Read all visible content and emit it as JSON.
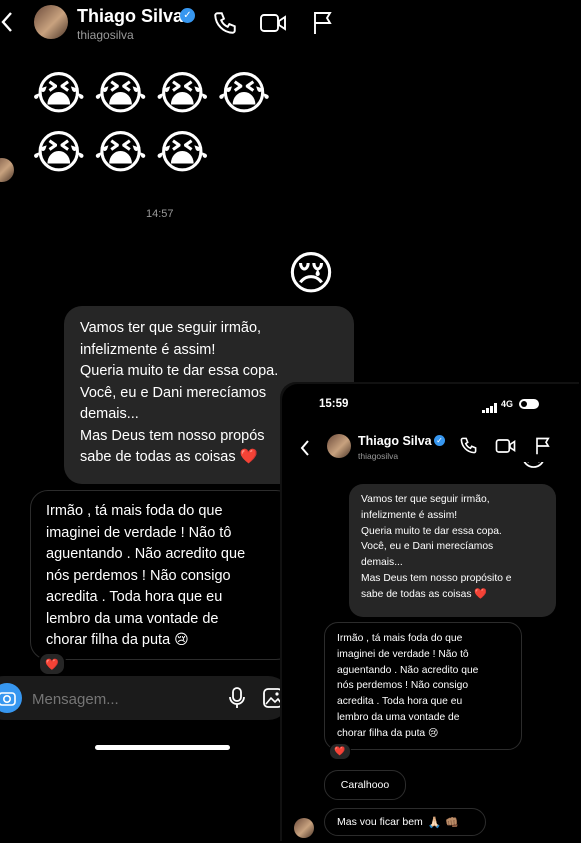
{
  "main": {
    "header": {
      "name": "Thiago Silva",
      "username": "thiagosilva",
      "back_glyph": "<",
      "icons": [
        "phone-icon",
        "video-icon",
        "flag-icon"
      ]
    },
    "emoji_rows": [
      [
        "😭",
        "😭",
        "😭",
        "😭"
      ],
      [
        "😭",
        "😭",
        "😭"
      ]
    ],
    "timestamp": "14:57",
    "sad_emoji": "😢",
    "sent_message": {
      "lines": [
        "Vamos ter que seguir irmão,",
        "infelizmente é assim!",
        "Queria muito te dar essa copa.",
        "Você, eu e Dani merecíamos",
        "demais...",
        "Mas Deus tem nosso propós",
        "sabe de todas as coisas"
      ],
      "heart": "❤️"
    },
    "received_message": {
      "lines": [
        "Irmão , tá mais foda do que",
        "imaginei de verdade ! Não tô",
        "aguentando . Não acredito que",
        "nós perdemos ! Não consigo",
        "acredita . Toda hora que eu",
        "lembro da uma vontade de",
        "chorar filha da puta"
      ],
      "end_emoji": "😢",
      "reaction": "❤️"
    },
    "composer": {
      "placeholder": "Mensagem...",
      "icons": [
        "camera-icon",
        "microphone-icon",
        "gallery-icon"
      ]
    }
  },
  "inset": {
    "status": {
      "time": "15:59",
      "network": "4G"
    },
    "header": {
      "name": "Thiago Silva",
      "username": "thiagosilva"
    },
    "sent_message": {
      "lines": [
        "Vamos ter que seguir irmão,",
        "infelizmente é assim!",
        "Queria muito te dar essa copa.",
        "Você, eu e Dani merecíamos",
        "demais...",
        "Mas Deus tem nosso propósito e",
        "sabe de todas as coisas"
      ],
      "heart": "❤️"
    },
    "received_message": {
      "lines": [
        "Irmão , tá mais foda do que",
        "imaginei de verdade ! Não tô",
        "aguentando . Não acredito que",
        "nós perdemos ! Não consigo",
        "acredita . Toda hora que eu",
        "lembro da uma vontade de",
        "chorar filha da puta"
      ],
      "end_emoji": "😢",
      "reaction": "❤️"
    },
    "message_2": "Caralhooo",
    "message_3": {
      "text": "Mas vou ficar bem",
      "emojis": "🙏🏻 👊🏽"
    }
  },
  "colors": {
    "verified": "#3797f0",
    "bubble": "#262626",
    "heart": "#e0245e",
    "emoji": "#f5c33b"
  }
}
